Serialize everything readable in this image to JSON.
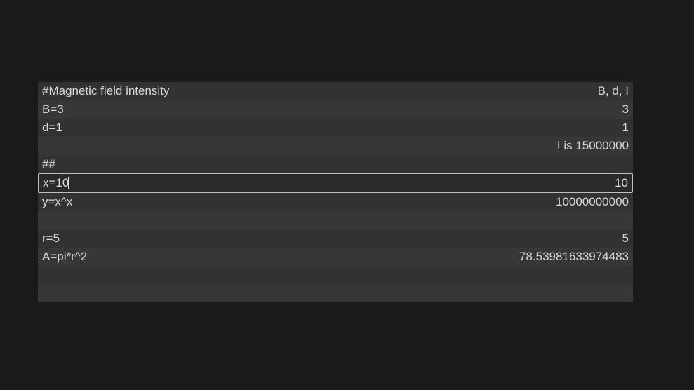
{
  "rows": [
    {
      "left": "#Magnetic field intensity",
      "right": "B, d, I",
      "bg": "a"
    },
    {
      "left": "B=3",
      "right": "3",
      "bg": "b"
    },
    {
      "left": "d=1",
      "right": "1",
      "bg": "a"
    },
    {
      "left": "",
      "right": "I is 15000000",
      "bg": "b"
    },
    {
      "left": "##",
      "right": "",
      "bg": "a"
    }
  ],
  "active": {
    "input": "x=10",
    "result": "10"
  },
  "rows2": [
    {
      "left": "y=x^x",
      "right": "10000000000",
      "bg": "a"
    },
    {
      "left": "",
      "right": "",
      "bg": "b"
    },
    {
      "left": "r=5",
      "right": "5",
      "bg": "a"
    },
    {
      "left": "A=pi*r^2",
      "right": "78.53981633974483",
      "bg": "b"
    },
    {
      "left": "",
      "right": "",
      "bg": "a"
    },
    {
      "left": "",
      "right": "",
      "bg": "b"
    }
  ]
}
